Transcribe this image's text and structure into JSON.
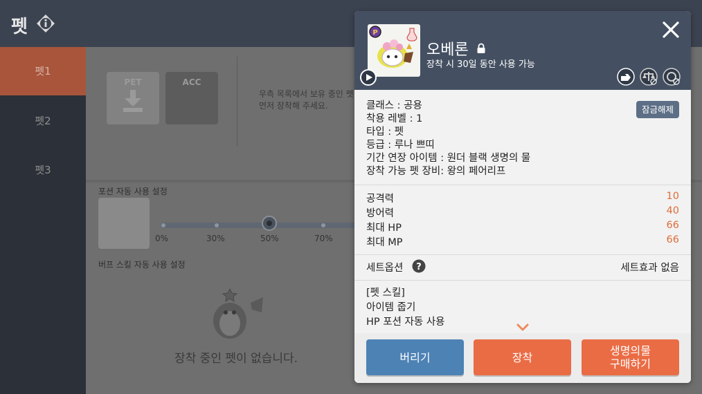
{
  "topbar": {
    "title": "펫"
  },
  "sidebar": {
    "tabs": [
      "펫1",
      "펫2",
      "펫3"
    ],
    "active": 0
  },
  "slots": {
    "pet": "PET",
    "acc": "ACC"
  },
  "hint": {
    "line1": "우측 목록에서 보유 중인 펫",
    "line2": "먼저 장착해 주세요."
  },
  "potion": {
    "title": "포션 자동 사용 설정",
    "ticks": [
      "0%",
      "30%",
      "50%",
      "70%"
    ],
    "selected": "50%"
  },
  "buff": {
    "title": "버프 스킬 자동 사용 설정",
    "empty": "장착 중인 펫이 없습니다."
  },
  "modal": {
    "name": "오베론",
    "subtitle": "장착 시 30일 동안 사용 가능",
    "unlock_label": "잠금해제",
    "props": [
      "클래스 : 공용",
      "착용 레벨 : 1",
      "타입 : 펫",
      "등급 : 루나 쁘띠",
      "기간 연장 아이템 : 원더 블랙 생명의 물",
      "장착 가능 펫 장비: 왕의 페어리프"
    ],
    "stats": [
      {
        "label": "공격력",
        "value": "10"
      },
      {
        "label": "방어력",
        "value": "40"
      },
      {
        "label": "최대 HP",
        "value": "66"
      },
      {
        "label": "최대 MP",
        "value": "66"
      }
    ],
    "set_label": "세트옵션",
    "set_value": "세트효과 없음",
    "skills": [
      "[펫 스킬]",
      "아이템 줍기",
      "HP 포션 자동 사용"
    ],
    "buttons": {
      "discard": "버리기",
      "equip": "장착",
      "buy": "생명의물\n구매하기"
    },
    "accent": "#e06c3a"
  }
}
